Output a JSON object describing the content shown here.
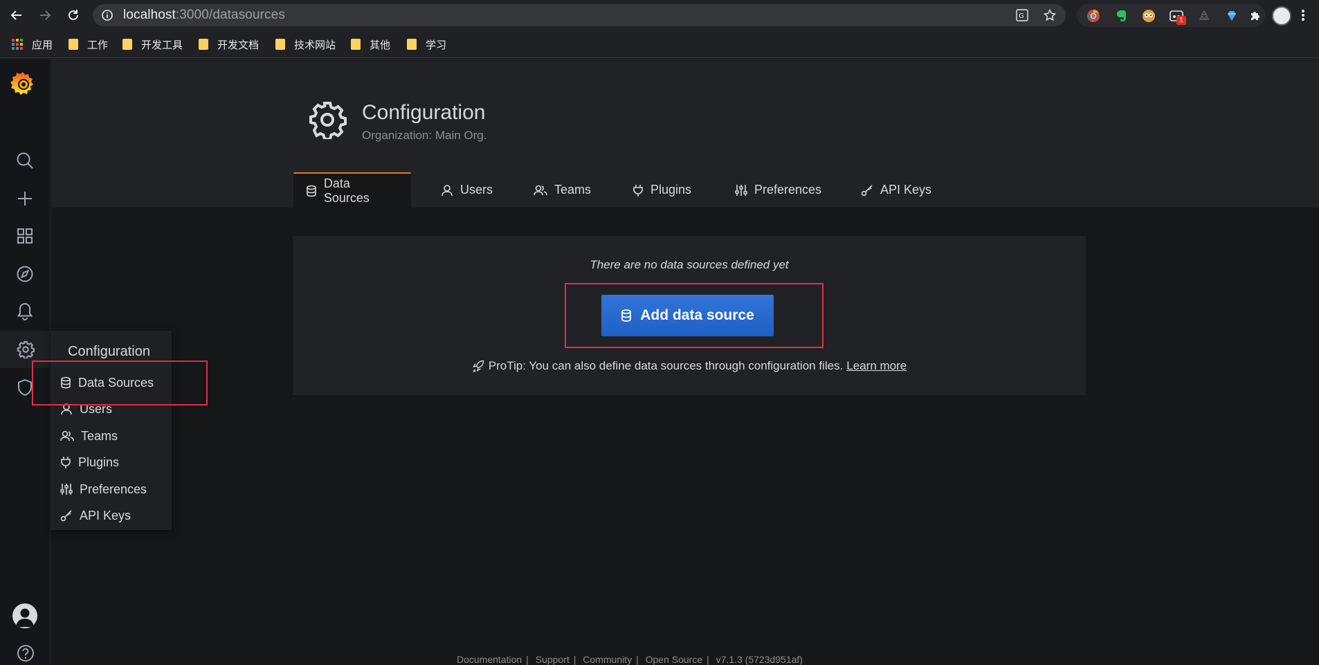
{
  "browser": {
    "url_host": "localhost",
    "url_path": ":3000/datasources",
    "bookmarks": [
      {
        "label": "应用",
        "kind": "apps"
      },
      {
        "label": "工作",
        "kind": "folder"
      },
      {
        "label": "开发工具",
        "kind": "folder"
      },
      {
        "label": "开发文档",
        "kind": "folder"
      },
      {
        "label": "技术网站",
        "kind": "folder"
      },
      {
        "label": "其他",
        "kind": "folder"
      },
      {
        "label": "学习",
        "kind": "folder"
      }
    ],
    "extension_badge": "1"
  },
  "sidemenu": {
    "flyout": {
      "title": "Configuration",
      "items": [
        {
          "label": "Data Sources",
          "icon": "database-icon"
        },
        {
          "label": "Users",
          "icon": "user-icon"
        },
        {
          "label": "Teams",
          "icon": "users-icon"
        },
        {
          "label": "Plugins",
          "icon": "plug-icon"
        },
        {
          "label": "Preferences",
          "icon": "sliders-icon"
        },
        {
          "label": "API Keys",
          "icon": "key-icon"
        }
      ]
    }
  },
  "header": {
    "title": "Configuration",
    "subtitle": "Organization: Main Org."
  },
  "tabs": [
    {
      "label": "Data Sources",
      "icon": "database-icon",
      "active": true
    },
    {
      "label": "Users",
      "icon": "user-icon",
      "active": false
    },
    {
      "label": "Teams",
      "icon": "users-icon",
      "active": false
    },
    {
      "label": "Plugins",
      "icon": "plug-icon",
      "active": false
    },
    {
      "label": "Preferences",
      "icon": "sliders-icon",
      "active": false
    },
    {
      "label": "API Keys",
      "icon": "key-icon",
      "active": false
    }
  ],
  "empty_state": {
    "message": "There are no data sources defined yet",
    "button_label": "Add data source",
    "protip_text": "ProTip: You can also define data sources through configuration files.",
    "protip_link": "Learn more"
  },
  "footer": {
    "documentation": "Documentation",
    "support": "Support",
    "community": "Community",
    "open_source": "Open Source",
    "version": "v7.1.3 (5723d951af)"
  },
  "colors": {
    "accent_orange": "#eb7b18",
    "primary_blue": "#3274d9",
    "annotation_red": "#e02f44"
  }
}
